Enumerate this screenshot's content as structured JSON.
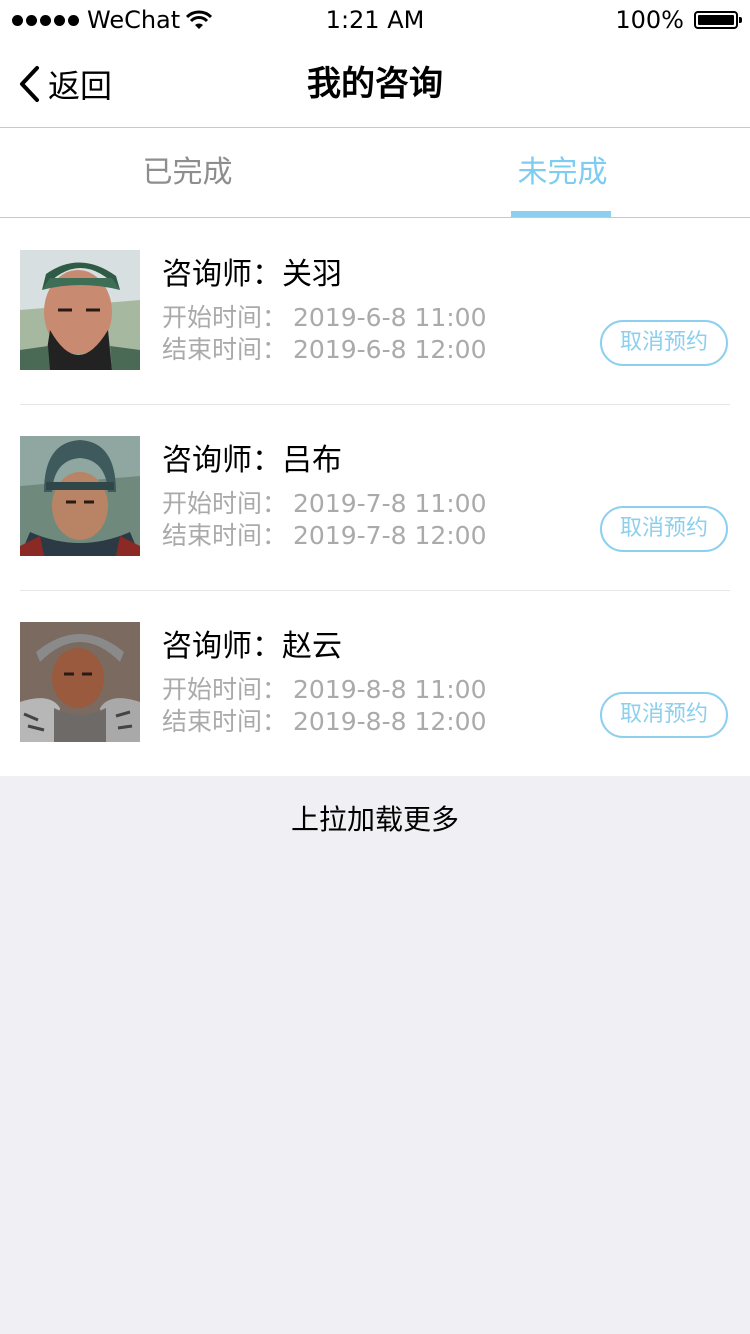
{
  "status_bar": {
    "carrier": "WeChat",
    "time": "1:21 AM",
    "battery": "100%"
  },
  "nav": {
    "back_label": "返回",
    "title": "我的咨询"
  },
  "tabs": [
    {
      "label": "已完成",
      "active": false
    },
    {
      "label": "未完成",
      "active": true
    }
  ],
  "items": [
    {
      "consultant_label": "咨询师：",
      "consultant": "关羽",
      "start_label": "开始时间：",
      "start": "2019-6-8  11:00",
      "end_label": "结束时间：",
      "end": "2019-6-8  12:00",
      "action": "取消预约"
    },
    {
      "consultant_label": "咨询师：",
      "consultant": "吕布",
      "start_label": "开始时间：",
      "start": "2019-7-8  11:00",
      "end_label": "结束时间：",
      "end": "2019-7-8  12:00",
      "action": "取消预约"
    },
    {
      "consultant_label": "咨询师：",
      "consultant": "赵云",
      "start_label": "开始时间：",
      "start": "2019-8-8  11:00",
      "end_label": "结束时间：",
      "end": "2019-8-8  12:00",
      "action": "取消预约"
    }
  ],
  "footer": {
    "load_more": "上拉加载更多"
  },
  "colors": {
    "accent": "#7ecdf1",
    "inactive_tab": "#8e8e8e",
    "secondary_text": "#aaaaaa",
    "background": "#efeff4"
  }
}
